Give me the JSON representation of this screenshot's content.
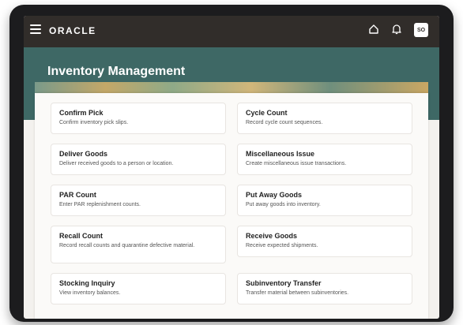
{
  "header": {
    "logo_text": "ORACLE",
    "avatar_initials": "SO"
  },
  "page": {
    "title": "Inventory Management"
  },
  "cards": [
    {
      "title": "Confirm Pick",
      "description": "Confirm inventory pick slips."
    },
    {
      "title": "Cycle Count",
      "description": "Record cycle count sequences."
    },
    {
      "title": "Deliver Goods",
      "description": "Deliver received goods to a person or location."
    },
    {
      "title": "Miscellaneous Issue",
      "description": "Create miscellaneous issue transactions."
    },
    {
      "title": "PAR Count",
      "description": "Enter PAR replenishment counts."
    },
    {
      "title": "Put Away Goods",
      "description": "Put away goods into inventory."
    },
    {
      "title": "Recall Count",
      "description": "Record recall counts and quarantine defective material."
    },
    {
      "title": "Receive Goods",
      "description": "Receive expected shipments."
    },
    {
      "title": "Stocking Inquiry",
      "description": "View inventory balances."
    },
    {
      "title": "Subinventory Transfer",
      "description": "Transfer material between subinventories."
    }
  ],
  "colors": {
    "topbar": "#312d2a",
    "hero": "#3e6865",
    "panel": "#fbfaf8"
  },
  "icons": [
    "hamburger-menu-icon",
    "home-icon",
    "bell-icon"
  ]
}
